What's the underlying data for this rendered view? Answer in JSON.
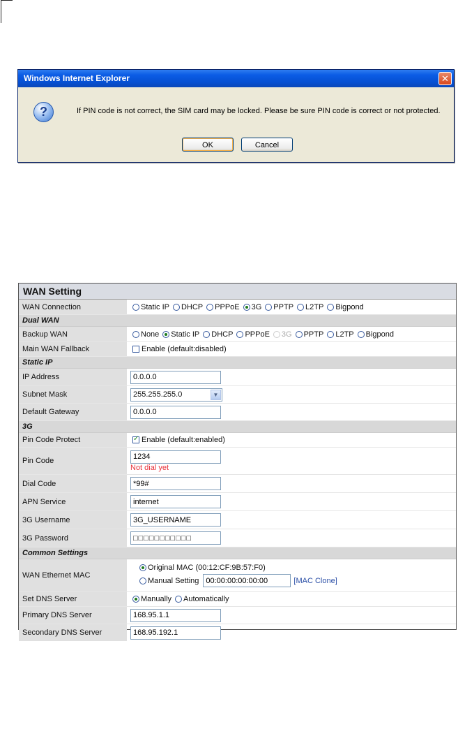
{
  "dialog": {
    "title": "Windows Internet Explorer",
    "close_glyph": "✕",
    "message": "If PIN code is not correct, the SIM card may be locked. Please be sure PIN code is correct or not protected.",
    "ok_label": "OK",
    "cancel_label": "Cancel"
  },
  "panel": {
    "title": "WAN Setting",
    "wan_connection": {
      "label": "WAN Connection",
      "options": [
        "Static IP",
        "DHCP",
        "PPPoE",
        "3G",
        "PPTP",
        "L2TP",
        "Bigpond"
      ],
      "selected": "3G"
    },
    "dual_wan": {
      "heading": "Dual WAN",
      "backup_wan": {
        "label": "Backup WAN",
        "options": [
          "None",
          "Static IP",
          "DHCP",
          "PPPoE",
          "3G",
          "PPTP",
          "L2TP",
          "Bigpond"
        ],
        "selected": "Static IP",
        "disabled": "3G"
      },
      "fallback": {
        "label": "Main WAN Fallback",
        "check_label": "Enable (default:disabled)",
        "checked": false
      }
    },
    "static_ip": {
      "heading": "Static IP",
      "ip_label": "IP Address",
      "ip_value": "0.0.0.0",
      "mask_label": "Subnet Mask",
      "mask_value": "255.255.255.0",
      "gateway_label": "Default Gateway",
      "gateway_value": "0.0.0.0"
    },
    "three_g": {
      "heading": "3G",
      "pin_protect": {
        "label": "Pin Code Protect",
        "check_label": "Enable (default:enabled)",
        "checked": true
      },
      "pin_code_label": "Pin Code",
      "pin_code_value": "1234",
      "pin_status": "Not dial yet",
      "dial_code_label": "Dial Code",
      "dial_code_value": "*99#",
      "apn_label": "APN Service",
      "apn_value": "internet",
      "username_label": "3G Username",
      "username_value": "3G_USERNAME",
      "password_label": "3G Password",
      "password_value": "□□□□□□□□□□□"
    },
    "common": {
      "heading": "Common Settings",
      "mac_label": "WAN Ethernet MAC",
      "original_mac": "Original MAC (00:12:CF:9B:57:F0)",
      "manual_setting": "Manual Setting",
      "manual_mac_value": "00:00:00:00:00:00",
      "mac_clone": "[MAC Clone]",
      "dns_label": "Set DNS Server",
      "dns_manual": "Manually",
      "dns_auto": "Automatically",
      "primary_label": "Primary DNS Server",
      "primary_value": "168.95.1.1",
      "secondary_label": "Secondary DNS Server",
      "secondary_value": "168.95.192.1"
    }
  }
}
